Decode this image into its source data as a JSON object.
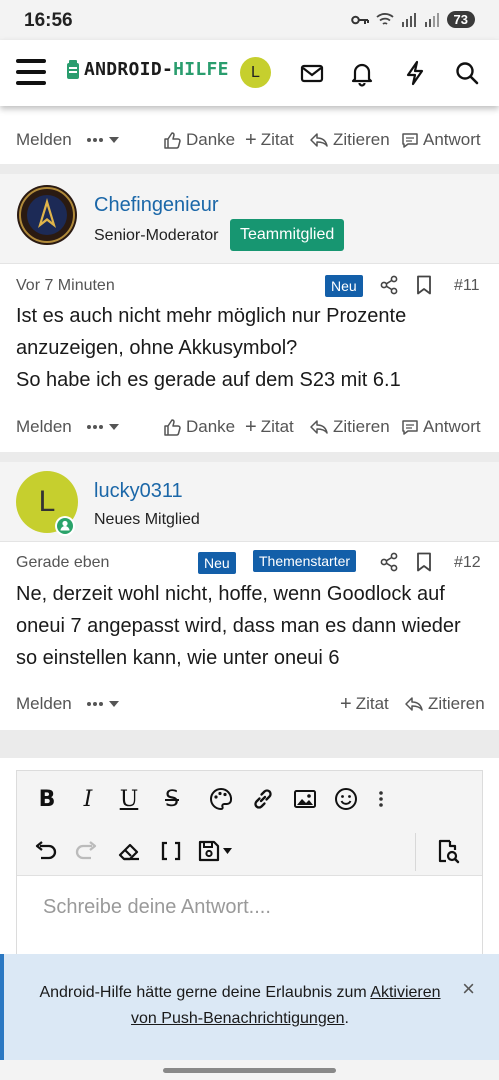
{
  "status_bar": {
    "time": "16:56",
    "battery": "73"
  },
  "header": {
    "logo_text_1": "ANDROID-",
    "logo_text_2": "HILFE",
    "avatar_letter": "L",
    "icons": [
      "menu-icon",
      "logo-icon",
      "mail-icon",
      "bell-icon",
      "bolt-icon",
      "search-icon"
    ]
  },
  "actions": {
    "report": "Melden",
    "thanks": "Danke",
    "quote_add": "Zitat",
    "quote": "Zitieren",
    "reply": "Antwort"
  },
  "posts": [
    {
      "username": "Chefingenieur",
      "user_title": "Senior-Moderator",
      "badge": "Teammitglied",
      "time": "Vor 7 Minuten",
      "new_label": "Neu",
      "number": "#11",
      "lines": [
        "Ist es auch nicht mehr möglich nur Prozente",
        "anzuzeigen, ohne Akkusymbol?",
        "So habe ich es gerade auf dem S23 mit 6.1"
      ]
    },
    {
      "username": "lucky0311",
      "avatar_letter": "L",
      "user_title": "Neues Mitglied",
      "time": "Gerade eben",
      "new_label": "Neu",
      "starter_label": "Themenstarter",
      "number": "#12",
      "lines": [
        "Ne, derzeit wohl nicht, hoffe, wenn Goodlock auf",
        "oneui 7 angepasst wird, dass man es dann wieder",
        "so einstellen kann, wie unter oneui 6"
      ]
    }
  ],
  "editor": {
    "placeholder": "Schreibe deine Antwort....",
    "toolbar_row1": [
      "bold",
      "italic",
      "underline",
      "strikethrough",
      "palette",
      "link",
      "image",
      "emoji",
      "more"
    ],
    "toolbar_row2": [
      "undo",
      "redo",
      "eraser",
      "brackets",
      "save",
      "preview"
    ]
  },
  "notice": {
    "text_before": "Android-Hilfe hätte gerne deine Erlaubnis zum ",
    "link_text": "Aktivieren von Push-Benachrichtigungen",
    "text_after": ".",
    "close": "×"
  },
  "colors": {
    "link_blue": "#1b67a8",
    "team_green": "#179671",
    "neu_blue": "#135fa9",
    "avatar_yellow": "#c6cf2e"
  }
}
